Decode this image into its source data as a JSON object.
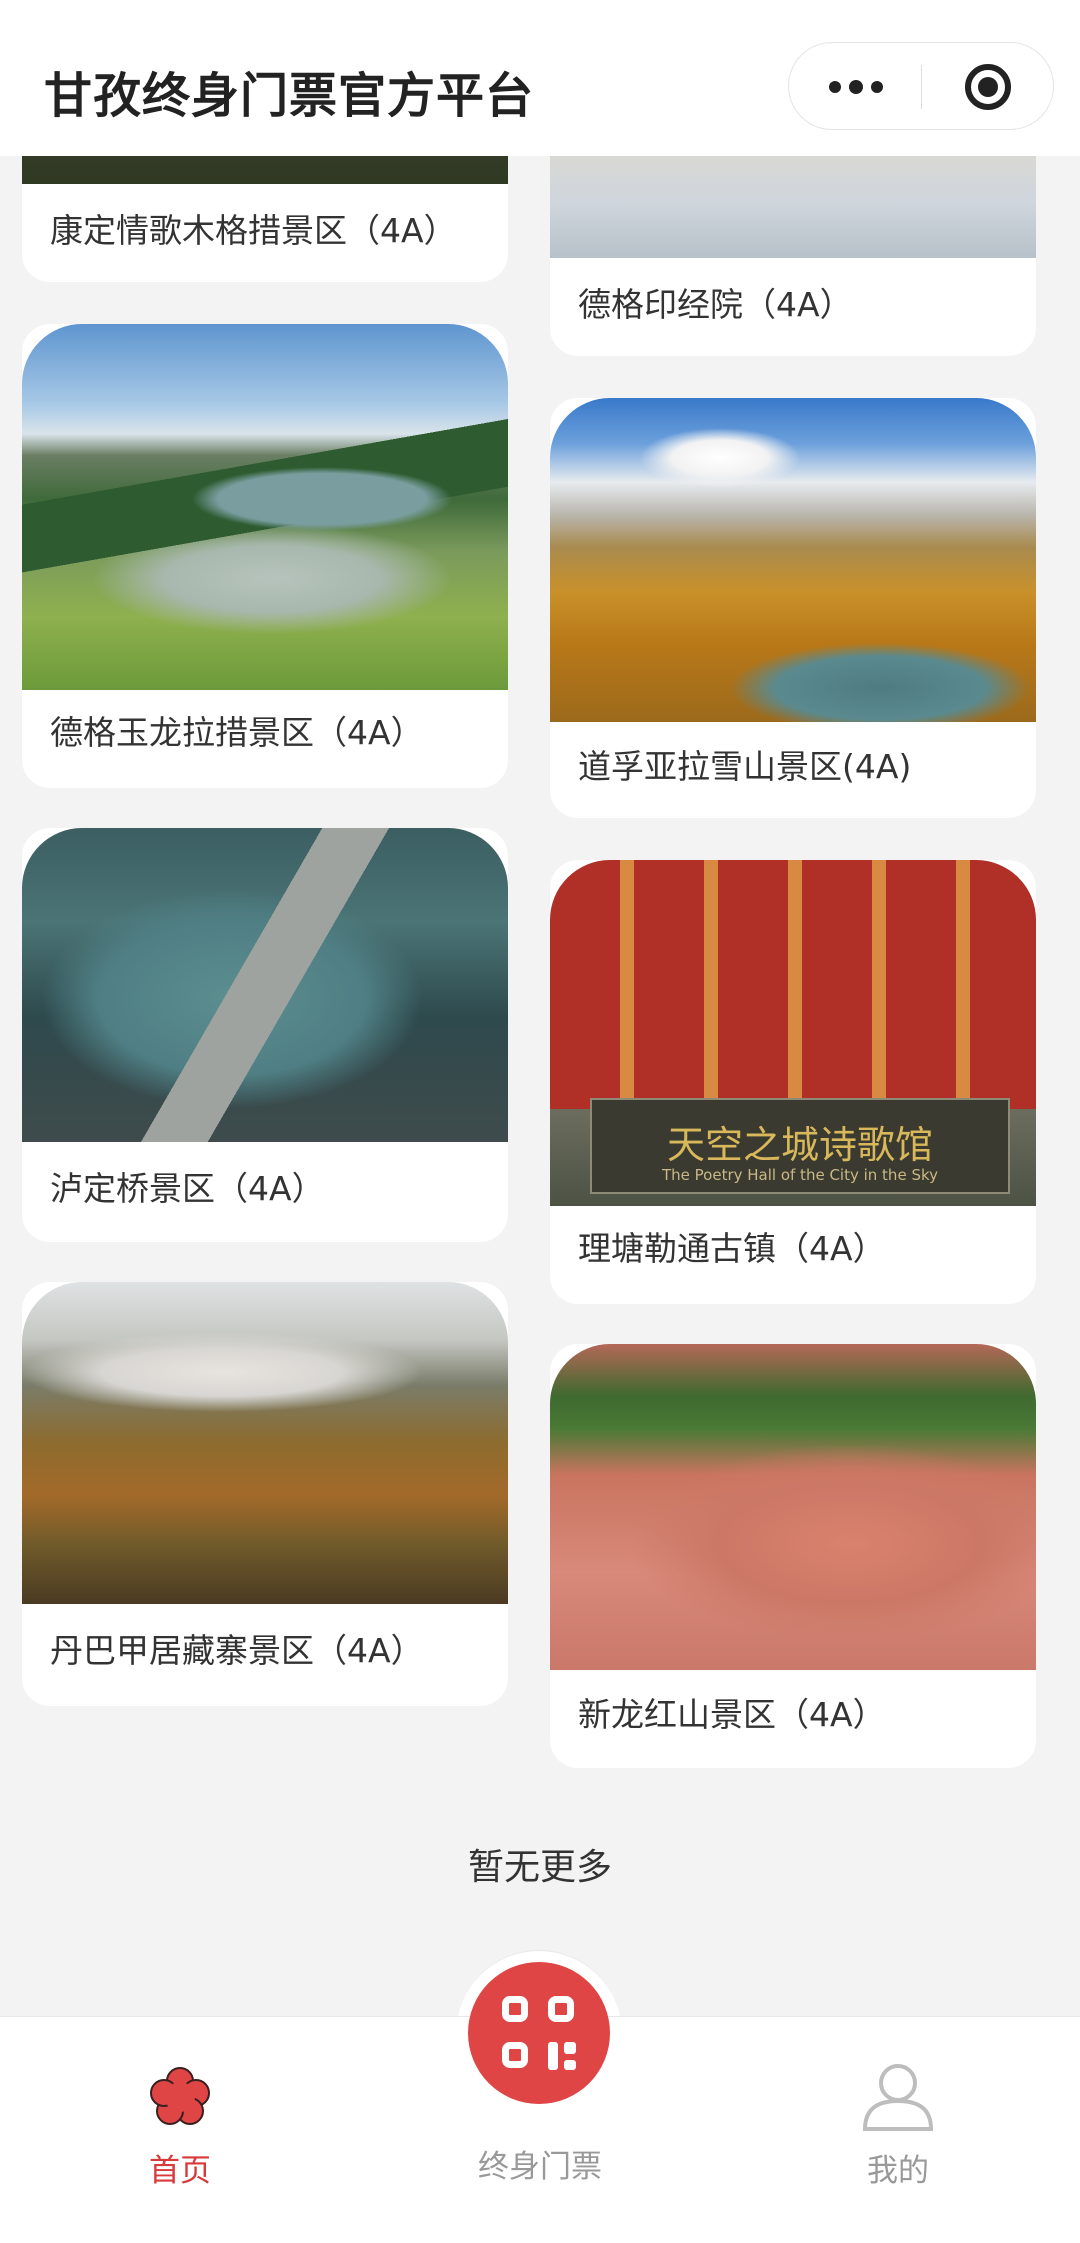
{
  "header": {
    "title": "甘孜终身门票官方平台",
    "more_icon": "more-dots-icon",
    "close_icon": "target-close-icon"
  },
  "spots": [
    {
      "name": "康定情歌木格措景区（4A）",
      "icon": "scenic-photo"
    },
    {
      "name": "德格印经院（4A）",
      "icon": "scenic-photo"
    },
    {
      "name": "德格玉龙拉措景区（4A）",
      "icon": "scenic-photo"
    },
    {
      "name": "道孚亚拉雪山景区(4A)",
      "icon": "scenic-photo"
    },
    {
      "name": "泸定桥景区（4A）",
      "icon": "scenic-photo"
    },
    {
      "name": "理塘勒通古镇（4A）",
      "icon": "scenic-photo"
    },
    {
      "name": "丹巴甲居藏寨景区（4A）",
      "icon": "scenic-photo"
    },
    {
      "name": "新龙红山景区（4A）",
      "icon": "scenic-photo"
    }
  ],
  "photo_text": {
    "litang_sign": "天空之城诗歌馆",
    "litang_sign_en": "The Poetry Hall of the City in the Sky"
  },
  "list_end_text": "暂无更多",
  "tabbar": {
    "home_label": "首页",
    "ticket_label": "终身门票",
    "mine_label": "我的",
    "active_color": "#d8393a",
    "inactive_color": "#999999",
    "center_button_color": "#e04545"
  }
}
